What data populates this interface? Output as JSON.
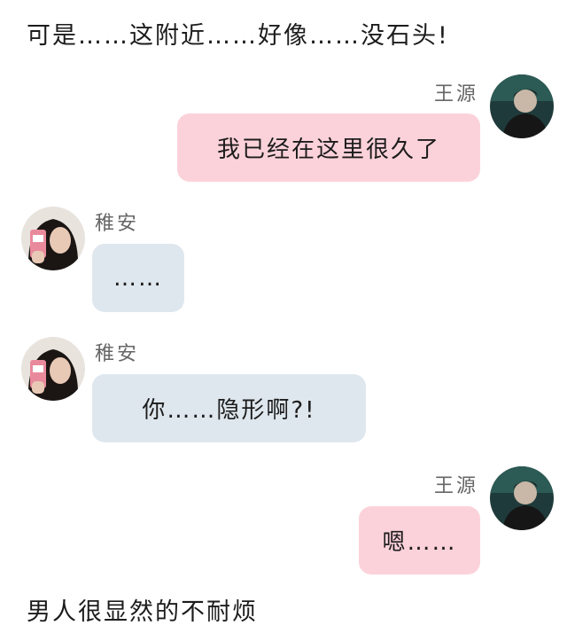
{
  "narration": {
    "top": "可是……这附近……好像……没石头!",
    "bottom": "男人很显然的不耐烦"
  },
  "colors": {
    "right_bubble": "#fcd2da",
    "left_bubble": "#dfe7ee",
    "name_text": "#666666"
  },
  "messages": [
    {
      "sender": "王源",
      "side": "right",
      "text": "我已经在这里很久了"
    },
    {
      "sender": "稚安",
      "side": "left",
      "text": "……"
    },
    {
      "sender": "稚安",
      "side": "left",
      "text": "你……隐形啊?!"
    },
    {
      "sender": "王源",
      "side": "right",
      "text": "嗯……"
    }
  ]
}
